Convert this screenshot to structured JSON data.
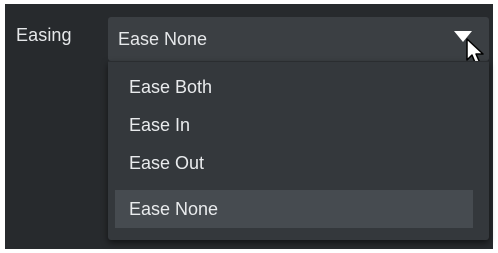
{
  "easing": {
    "label": "Easing",
    "selected_value": "Ease None",
    "options": [
      {
        "label": "Ease Both",
        "selected": false
      },
      {
        "label": "Ease In",
        "selected": false
      },
      {
        "label": "Ease Out",
        "selected": false
      },
      {
        "label": "Ease None",
        "selected": true
      }
    ]
  },
  "icons": {
    "caret": "dropdown-caret-icon",
    "cursor": "mouse-pointer-icon"
  },
  "colors": {
    "panel_bg": "#272a2d",
    "select_bg": "#3b3f43",
    "dropdown_bg": "#34383c",
    "selected_option_bg": "#464b50",
    "text": "#e6e8ea"
  }
}
